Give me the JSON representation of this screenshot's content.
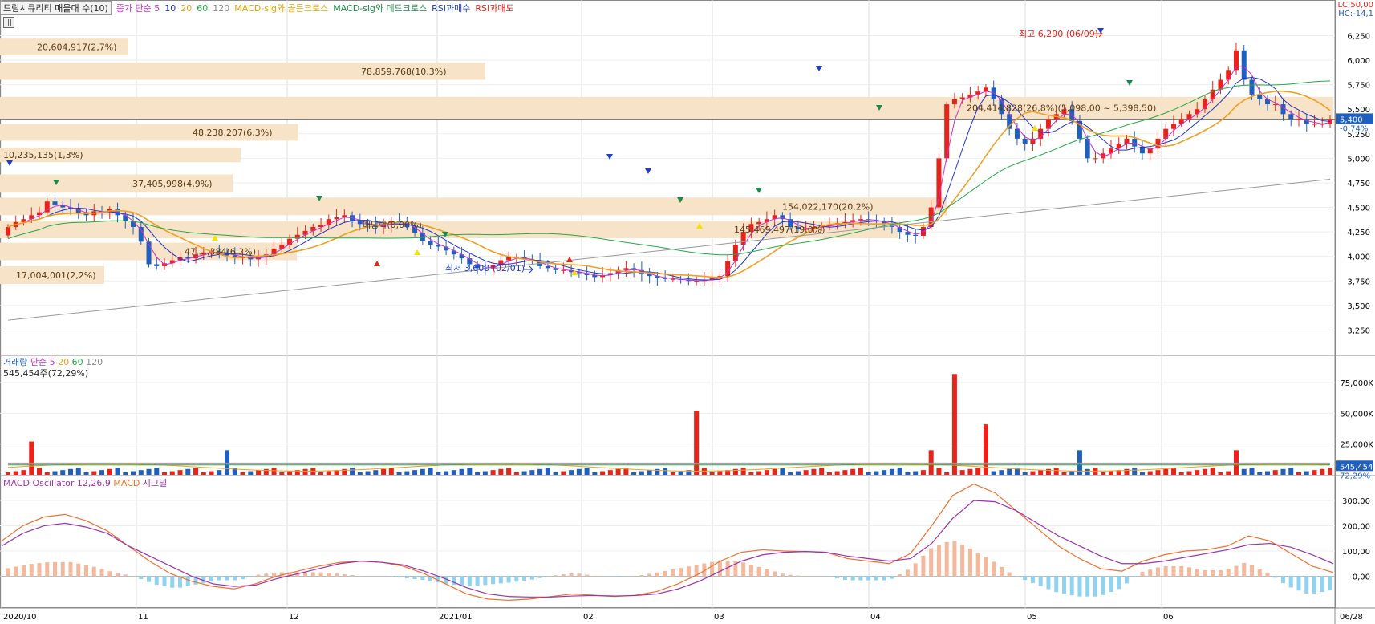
{
  "header": {
    "title": "드림시큐리티 매물대 수(10)",
    "ma": {
      "label": "종가 단순",
      "p5": "5",
      "p10": "10",
      "p20": "20",
      "p60": "60",
      "p120": "120"
    },
    "sig1": "MACD-sig와 골든크로스",
    "sig2": "MACD-sig와 데드크로스",
    "rsi_buy": "RSI과매수",
    "rsi_sell": "RSI과매도",
    "lc": "LC:50,00",
    "hc": "HC:-14,1"
  },
  "volume_header": {
    "title": "거래량",
    "label": "단순",
    "p5": "5",
    "p20": "20",
    "p60": "60",
    "p120": "120",
    "current": "545,454주(72,29%)"
  },
  "macd_header": {
    "title": "MACD Oscillator 12,26,9",
    "macd": "MACD",
    "signal": "시그널"
  },
  "annotations": {
    "high": "최고 6,290 (06/09)",
    "low": "최저 3,600 (02/01)",
    "current_price_range": "204,414,828(26,8%)(5,098,00 ~ 5,398,50)",
    "dividend": "배당락(0,00%)",
    "price_tag": "5,400",
    "price_change": "-0,74%",
    "volume_tag": "545,454",
    "volume_pct": "72,29%"
  },
  "colors": {
    "up": "#e8231a",
    "down": "#1f5fbf",
    "ma5": "#cc2fcc",
    "ma10": "#2233cc",
    "ma20": "#f0a020",
    "ma60": "#22aa44",
    "ma120": "#999999",
    "macd": "#f07030",
    "signal": "#9933aa",
    "osc_pos": "#f5b89a",
    "osc_neg": "#8fd3f0",
    "band": "#f7e3c8"
  },
  "chart_data": [
    {
      "type": "candlestick",
      "title": "드림시큐리티",
      "x_ticks": [
        "2020/10",
        "11",
        "12",
        "2021/01",
        "02",
        "03",
        "04",
        "05",
        "06",
        "06/28"
      ],
      "y_ticks": [
        "6,250",
        "6,000",
        "5,750",
        "5,500",
        "5,250",
        "5,000",
        "4,750",
        "4,500",
        "4,250",
        "4,000",
        "3,750",
        "3,500",
        "3,250"
      ],
      "ylim": [
        3000,
        6450
      ],
      "ohlc_approx": {
        "close_path": [
          4300,
          4350,
          4380,
          4420,
          4450,
          4560,
          4520,
          4500,
          4480,
          4440,
          4420,
          4460,
          4450,
          4480,
          4420,
          4360,
          4300,
          4150,
          3920,
          3900,
          3930,
          3960,
          3990,
          3980,
          4020,
          4040,
          4050,
          4040,
          4010,
          3990,
          3990,
          3970,
          3990,
          4020,
          4080,
          4120,
          4180,
          4220,
          4260,
          4300,
          4320,
          4380,
          4400,
          4420,
          4360,
          4330,
          4320,
          4300,
          4320,
          4360,
          4350,
          4300,
          4240,
          4160,
          4120,
          4100,
          4060,
          4020,
          3980,
          3920,
          3880,
          3870,
          3910,
          3960,
          3990,
          3990,
          3970,
          3950,
          3900,
          3880,
          3860,
          3860,
          3840,
          3830,
          3810,
          3790,
          3810,
          3830,
          3860,
          3880,
          3860,
          3820,
          3800,
          3780,
          3770,
          3770,
          3760,
          3750,
          3750,
          3760,
          3780,
          3800,
          3950,
          4120,
          4250,
          4330,
          4350,
          4380,
          4420,
          4380,
          4300,
          4280,
          4280,
          4300,
          4310,
          4320,
          4340,
          4350,
          4370,
          4380,
          4370,
          4360,
          4330,
          4300,
          4250,
          4220,
          4210,
          4300,
          4500,
          5000,
          5550,
          5600,
          5620,
          5650,
          5680,
          5720,
          5600,
          5450,
          5300,
          5200,
          5150,
          5200,
          5300,
          5400,
          5450,
          5500,
          5380,
          5200,
          5000,
          5000,
          5050,
          5100,
          5150,
          5200,
          5120,
          5050,
          5100,
          5200,
          5300,
          5350,
          5400,
          5450,
          5500,
          5600,
          5700,
          5800,
          5900,
          6100,
          5800,
          5650,
          5600,
          5550,
          5550,
          5450,
          5400,
          5400,
          5350,
          5350,
          5350,
          5400
        ],
        "high": 6290,
        "low": 3600
      },
      "moving_averages": [
        "5",
        "10",
        "20",
        "60",
        "120"
      ],
      "volume_profile": [
        {
          "label": "20,604,917(2,7%)",
          "price_low": 6050,
          "price_high": 6220
        },
        {
          "label": "78,859,768(10,3%)",
          "price_low": 5800,
          "price_high": 5975
        },
        {
          "label": "204,414,828(26,8%)(5,098,00 ~ 5,398,50)",
          "price_low": 5400,
          "price_high": 5625
        },
        {
          "label": "48,238,207(6,3%)",
          "price_low": 5180,
          "price_high": 5350
        },
        {
          "label": "10,235,135(1,3%)",
          "price_low": 4960,
          "price_high": 5110
        },
        {
          "label": "37,405,998(4,9%)",
          "price_low": 4650,
          "price_high": 4835
        },
        {
          "label": "154,022,170(20,2%)",
          "price_low": 4420,
          "price_high": 4600
        },
        {
          "label": "145,469,497(19,0%)",
          "price_low": 4185,
          "price_high": 4365
        },
        {
          "label": "47,...,384(6,2%)",
          "price_low": 3960,
          "price_high": 4140
        },
        {
          "label": "17,004,001(2,2%)",
          "price_low": 3720,
          "price_high": 3900
        }
      ]
    },
    {
      "type": "bar",
      "title": "거래량",
      "y_ticks": [
        "75,000K",
        "50,000K",
        "25,000K"
      ],
      "ylim": [
        0,
        90000
      ],
      "spikes_k": [
        {
          "x": "2020/10",
          "value": 27000
        },
        {
          "x": "11 (late)",
          "value": 20000
        },
        {
          "x": "02 (late)",
          "value": 52000
        },
        {
          "x": "04 (early)",
          "value": 20000
        },
        {
          "x": "04",
          "value": 82000
        },
        {
          "x": "04 (mid)",
          "value": 41000
        },
        {
          "x": "05",
          "value": 20000
        },
        {
          "x": "06",
          "value": 20000
        }
      ],
      "current": 545454
    },
    {
      "type": "line",
      "title": "MACD Oscillator 12,26,9",
      "series_names": [
        "MACD",
        "시그널"
      ],
      "y_ticks": [
        "300,00",
        "200,00",
        "100,00",
        "0,00"
      ],
      "ylim": [
        -100,
        370
      ],
      "macd_path": [
        140,
        200,
        235,
        245,
        220,
        180,
        120,
        60,
        10,
        -20,
        -40,
        -50,
        -30,
        0,
        20,
        40,
        55,
        60,
        55,
        40,
        10,
        -30,
        -70,
        -90,
        -95,
        -90,
        -80,
        -70,
        -75,
        -80,
        -75,
        -60,
        -30,
        10,
        60,
        95,
        105,
        100,
        98,
        95,
        70,
        60,
        50,
        90,
        200,
        320,
        365,
        330,
        260,
        190,
        120,
        70,
        30,
        20,
        60,
        85,
        100,
        105,
        120,
        160,
        140,
        90,
        40,
        15
      ],
      "signal_path": [
        120,
        170,
        200,
        210,
        195,
        170,
        120,
        80,
        40,
        0,
        -30,
        -40,
        -35,
        -10,
        10,
        30,
        50,
        60,
        55,
        45,
        20,
        -10,
        -45,
        -70,
        -80,
        -82,
        -82,
        -78,
        -76,
        -78,
        -76,
        -70,
        -50,
        -20,
        20,
        60,
        85,
        95,
        98,
        95,
        80,
        70,
        60,
        70,
        130,
        230,
        300,
        295,
        260,
        210,
        160,
        120,
        80,
        50,
        50,
        60,
        75,
        90,
        105,
        125,
        130,
        115,
        85,
        50
      ]
    }
  ]
}
